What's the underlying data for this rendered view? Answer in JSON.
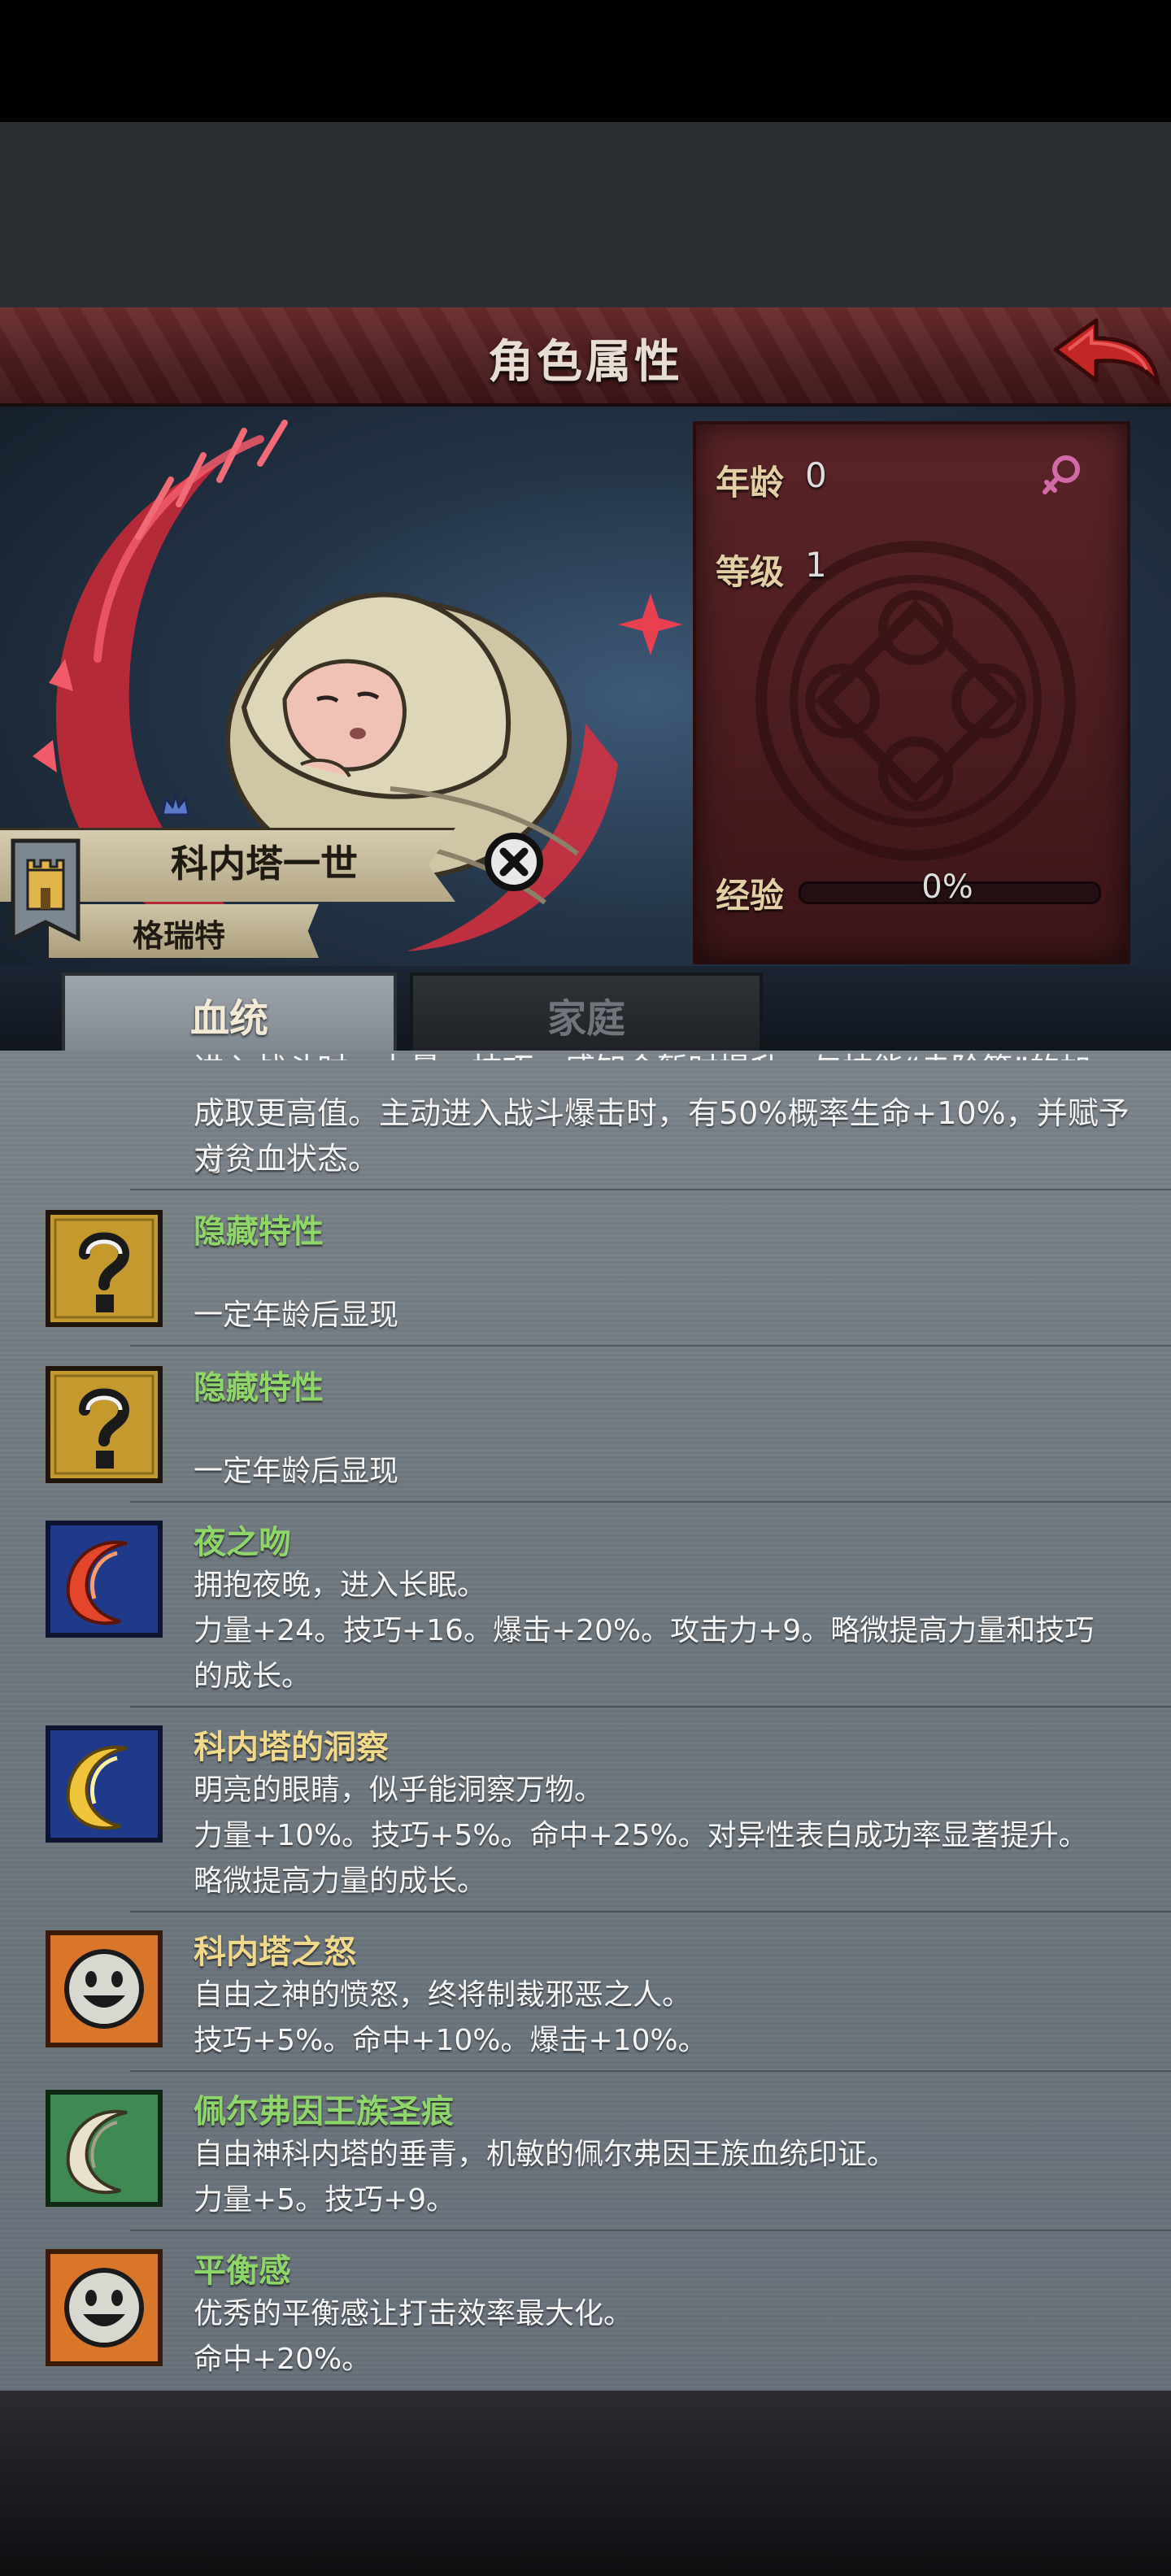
{
  "header": {
    "title": "角色属性",
    "back_icon": "back-arrow-icon"
  },
  "character": {
    "name": "科内塔一世",
    "family": "格瑞特",
    "portrait": "swaddled-baby",
    "gender_icon": "female-symbol-icon"
  },
  "stats": {
    "age_label": "年龄",
    "age_value": "0",
    "level_label": "等级",
    "level_value": "1",
    "exp_label": "经验",
    "exp_value": "0%",
    "exp_fraction": 0
  },
  "tabs": [
    {
      "label": "血统",
      "active": true
    },
    {
      "label": "家庭",
      "active": false
    }
  ],
  "partial_trait": {
    "line1": "进入战斗时，力量、技巧、感知会暂时提升，与技能“赤阶篇”的加",
    "line2": "成取更高值。主动进入战斗爆击时，有50%概率生命+10%，并赋予对",
    "line3": "方贫血状态。"
  },
  "traits": [
    {
      "icon": "question-mark-icon",
      "name": "隐藏特性",
      "line1": "",
      "line2": "一定年龄后显现",
      "line3": ""
    },
    {
      "icon": "question-mark-icon",
      "name": "隐藏特性",
      "line1": "",
      "line2": "一定年龄后显现",
      "line3": ""
    },
    {
      "icon": "red-crescent-icon",
      "name": "夜之吻",
      "line1": "拥抱夜晚，进入长眠。",
      "line2": "力量+24。技巧+16。爆击+20%。攻击力+9。略微提高力量和技巧",
      "line3": "的成长。"
    },
    {
      "icon": "gold-crescent-icon",
      "name": "科内塔的洞察",
      "line1": "明亮的眼睛，似乎能洞察万物。",
      "line2": "力量+10%。技巧+5%。命中+25%。对异性表白成功率显著提升。",
      "line3": "略微提高力量的成长。"
    },
    {
      "icon": "smiley-face-icon",
      "name": "科内塔之怒",
      "line1": "自由之神的愤怒，终将制裁邪恶之人。",
      "line2": "技巧+5%。命中+10%。爆击+10%。",
      "line3": ""
    },
    {
      "icon": "white-crescent-icon",
      "name": "佩尔弗因王族圣痕",
      "line1": "自由神科内塔的垂青，机敏的佩尔弗因王族血统印证。",
      "line2": "力量+5。技巧+9。",
      "line3": ""
    },
    {
      "icon": "smiley-face-icon",
      "name": "平衡感",
      "line1": "优秀的平衡感让打击效率最大化。",
      "line2": "命中+20%。",
      "line3": ""
    }
  ],
  "colors": {
    "trait_green": "#8fd66a",
    "trait_gold": "#f0d98a",
    "title_banner": "#5a2427"
  }
}
